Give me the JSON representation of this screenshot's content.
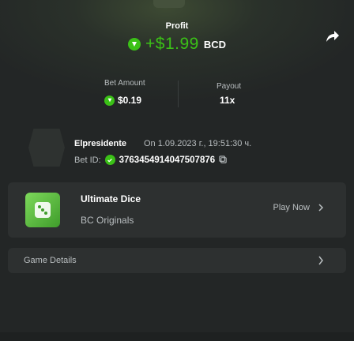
{
  "colors": {
    "accent": "#3bc117",
    "background": "#232626",
    "card": "#2d3030",
    "muted": "#b9bec0"
  },
  "header": {
    "profit_label": "Profit",
    "profit_value": "+$1.99",
    "currency": "BCD",
    "coin_icon": "bcd-coin-icon",
    "share_icon": "share-icon"
  },
  "stats": {
    "bet_amount_label": "Bet Amount",
    "bet_amount_value": "$0.19",
    "payout_label": "Payout",
    "payout_value": "11x"
  },
  "player": {
    "name": "Elpresidente",
    "meta": "On 1.09.2023 г., 19:51:30 ч.",
    "bet_id_label": "Bet ID:",
    "bet_id_value": "3763454914047507876"
  },
  "game": {
    "title": "Ultimate Dice",
    "provider": "BC Originals",
    "play_label": "Play Now"
  },
  "details": {
    "label": "Game Details"
  }
}
